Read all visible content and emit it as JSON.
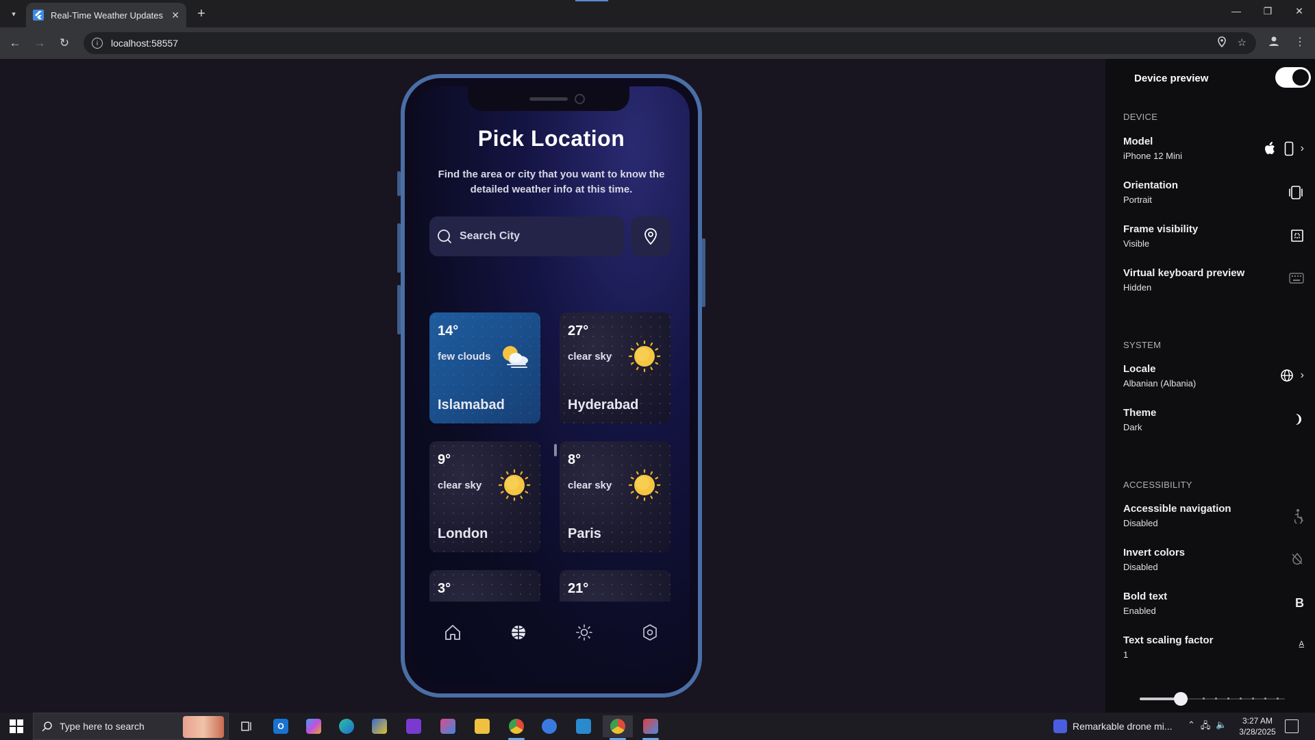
{
  "browser": {
    "tab_title": "Real-Time Weather Updates",
    "url": "localhost:58557"
  },
  "app": {
    "title": "Pick Location",
    "subtitle": "Find the area or city that you want to know the detailed weather info at this time.",
    "search_placeholder": "Search City",
    "cards": [
      {
        "temp": "14°",
        "condition": "few clouds",
        "city": "Islamabad",
        "icon": "few-clouds-icon",
        "active": true
      },
      {
        "temp": "27°",
        "condition": "clear sky",
        "city": "Hyderabad",
        "icon": "sun-icon",
        "active": false
      },
      {
        "temp": "9°",
        "condition": "clear sky",
        "city": "London",
        "icon": "sun-icon",
        "active": false
      },
      {
        "temp": "8°",
        "condition": "clear sky",
        "city": "Paris",
        "icon": "sun-icon",
        "active": false
      },
      {
        "temp": "3°",
        "condition": "",
        "city": "",
        "icon": "",
        "active": false
      },
      {
        "temp": "21°",
        "condition": "",
        "city": "",
        "icon": "",
        "active": false
      }
    ],
    "bottom_nav": [
      "home-icon",
      "globe-icon",
      "brightness-icon",
      "settings-icon"
    ]
  },
  "panel": {
    "header": "Device preview",
    "toggle_on": true,
    "sections": {
      "device": "DEVICE",
      "system": "SYSTEM",
      "accessibility": "ACCESSIBILITY"
    },
    "rows": {
      "model": {
        "title": "Model",
        "value": "iPhone 12 Mini"
      },
      "orientation": {
        "title": "Orientation",
        "value": "Portrait"
      },
      "frame": {
        "title": "Frame visibility",
        "value": "Visible"
      },
      "keyboard": {
        "title": "Virtual keyboard preview",
        "value": "Hidden"
      },
      "locale": {
        "title": "Locale",
        "value": "Albanian (Albania)"
      },
      "theme": {
        "title": "Theme",
        "value": "Dark"
      },
      "acc_nav": {
        "title": "Accessible navigation",
        "value": "Disabled"
      },
      "invert": {
        "title": "Invert colors",
        "value": "Disabled"
      },
      "bold": {
        "title": "Bold text",
        "value": "Enabled"
      },
      "scaling": {
        "title": "Text scaling factor",
        "value": "1"
      }
    },
    "bold_icon_glyph": "B",
    "scaling_icon_glyph": "A"
  },
  "taskbar": {
    "search_placeholder": "Type here to search",
    "news": "Remarkable drone mi...",
    "time": "3:27 AM",
    "date": "3/28/2025"
  }
}
